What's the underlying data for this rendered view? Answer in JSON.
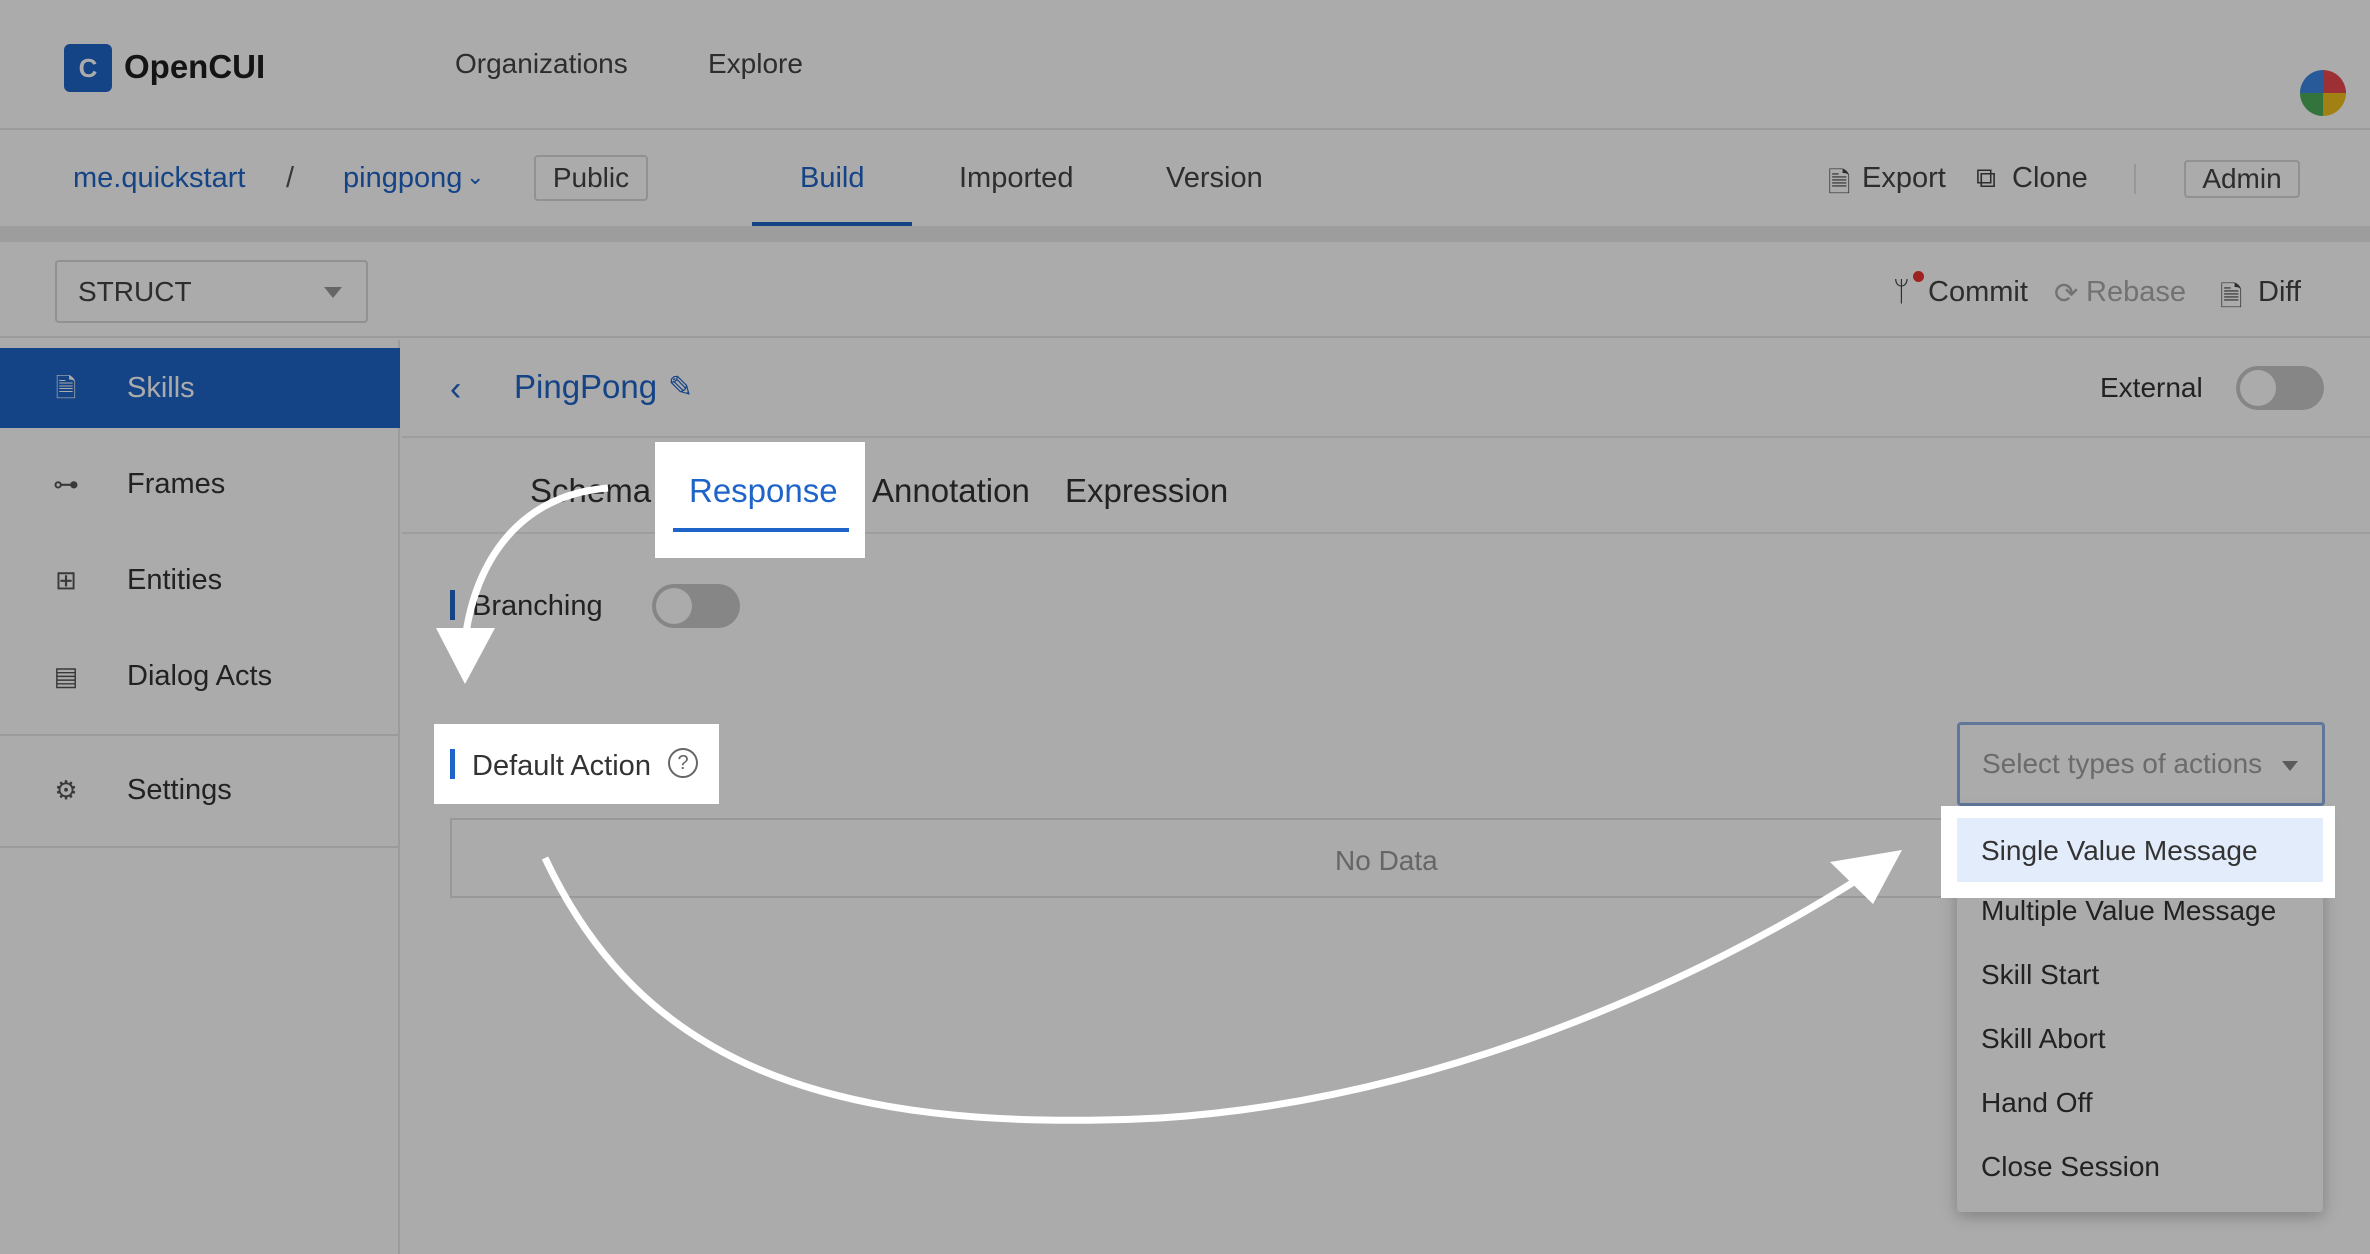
{
  "app": {
    "logo_glyph": "C",
    "name": "OpenCUI"
  },
  "topnav": {
    "items": [
      "Organizations",
      "Explore"
    ]
  },
  "project": {
    "org": "me.quickstart",
    "separator": "/",
    "name": "pingpong",
    "visibility": "Public",
    "tabs": [
      "Build",
      "Imported",
      "Version"
    ],
    "active_tab": "Build",
    "actions": {
      "export": "Export",
      "clone": "Clone",
      "admin": "Admin"
    }
  },
  "toolbar": {
    "struct_select": "STRUCT",
    "commit": "Commit",
    "rebase": "Rebase",
    "diff": "Diff"
  },
  "sidebar": {
    "items": [
      {
        "label": "Skills",
        "icon": "file-icon",
        "active": true
      },
      {
        "label": "Frames",
        "icon": "frames-icon"
      },
      {
        "label": "Entities",
        "icon": "entities-icon"
      },
      {
        "label": "Dialog Acts",
        "icon": "dialog-acts-icon"
      },
      {
        "label": "Settings",
        "icon": "gear-icon"
      }
    ]
  },
  "main": {
    "skill_name": "PingPong",
    "external_label": "External",
    "external_on": false,
    "tabs": [
      "Schema",
      "Response",
      "Annotation",
      "Expression"
    ],
    "active_tab": "Response",
    "branching_label": "Branching",
    "branching_on": false,
    "default_action_label": "Default Action",
    "no_data": "No Data",
    "action_select_placeholder": "Select types of actions",
    "action_options": [
      "Single Value Message",
      "Multiple Value Message",
      "Skill Start",
      "Skill Abort",
      "Hand Off",
      "Close Session"
    ],
    "highlighted_option": "Single Value Message"
  },
  "colors": {
    "accent": "#1f64c8",
    "overlay": "rgba(0,0,0,0.33)"
  }
}
